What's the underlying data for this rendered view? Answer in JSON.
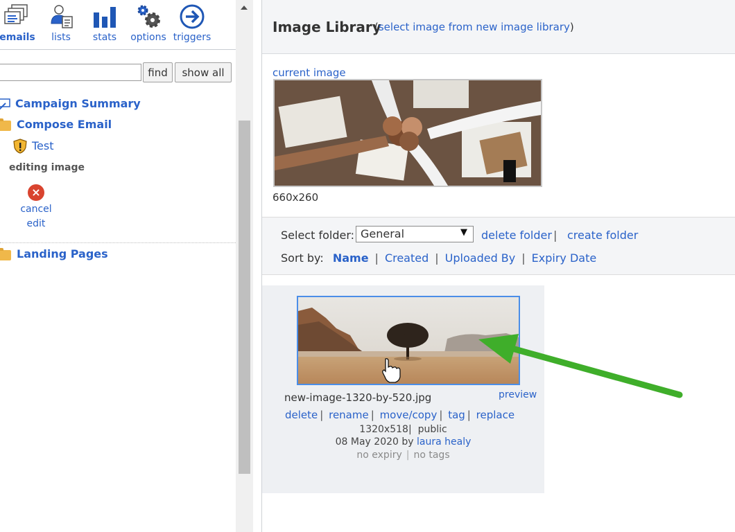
{
  "toolbar": {
    "items": [
      {
        "label": "emails",
        "icon": "emails-icon",
        "active": true
      },
      {
        "label": "lists",
        "icon": "lists-icon"
      },
      {
        "label": "stats",
        "icon": "stats-icon"
      },
      {
        "label": "options",
        "icon": "options-icon"
      },
      {
        "label": "triggers",
        "icon": "triggers-icon"
      }
    ]
  },
  "search": {
    "value": "",
    "find_label": "find",
    "show_all_label": "show all"
  },
  "tree": {
    "campaign_summary": "Campaign Summary",
    "compose_email": "Compose Email",
    "test": "Test",
    "editing_label": "editing image",
    "cancel_label": "cancel",
    "edit_label": "edit",
    "landing_pages": "Landing Pages"
  },
  "library": {
    "title": "Image Library",
    "subtitle_open": "(",
    "subtitle_link": "select image from new image library",
    "subtitle_close": ")",
    "current_label": "current image",
    "current_dims": "660x260",
    "select_folder_label": "Select folder:",
    "folder_value": "General",
    "delete_folder": "delete folder",
    "folder_sep": "|",
    "create_folder": "create folder",
    "sort_label": "Sort by:",
    "sort_options": [
      "Name",
      "Created",
      "Uploaded By",
      "Expiry Date"
    ],
    "sort_sep": "|"
  },
  "card": {
    "filename": "new-image-1320-by-520.jpg",
    "preview": "preview",
    "actions": [
      "delete",
      "rename",
      "move/copy",
      "tag",
      "replace"
    ],
    "sep": "|",
    "dims": "1320x518",
    "visibility": "public",
    "date_prefix": "08 May 2020 by",
    "uploader": "laura healy",
    "expiry": "no expiry",
    "tags": "no tags"
  },
  "colors": {
    "link": "#2a62c9",
    "annotation_arrow": "#3fae2a",
    "selected_border": "#4b8ee8"
  }
}
